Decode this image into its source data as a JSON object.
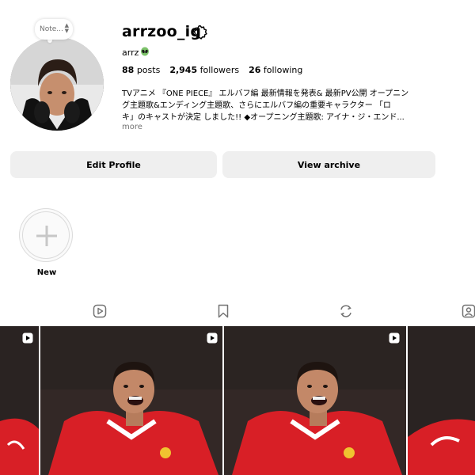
{
  "profile": {
    "username": "arrzoo_ig",
    "full_name": "arrz",
    "note_placeholder": "Note...",
    "stats": {
      "posts_count": "88",
      "posts_label": "posts",
      "followers_count": "2,945",
      "followers_label": "followers",
      "following_count": "26",
      "following_label": "following"
    },
    "bio_line1": "TVアニメ 『ONE PIECE』 エルバフ編 最新情報を発表& 最新PV公開 オープニン",
    "bio_line2": "グ主題歌&エンディング主題歌、さらにエルバフ編の重要キャラクター 「ロ",
    "bio_line3": "キ」のキャストが決定 しました!! ◆オープニング主題歌: アイナ・ジ・エンド...",
    "more_label": "more"
  },
  "actions": {
    "edit_profile_label": "Edit Profile",
    "view_archive_label": "View archive"
  },
  "highlights": {
    "new_label": "New"
  },
  "colors": {
    "button_bg": "#efefef",
    "secondary_text": "#737373",
    "jersey_red": "#d81f26"
  },
  "icons": [
    "gear-icon",
    "alien-icon",
    "plus-icon",
    "reels-icon",
    "saved-icon",
    "reposts-icon",
    "tagged-icon",
    "reel-badge-icon"
  ]
}
